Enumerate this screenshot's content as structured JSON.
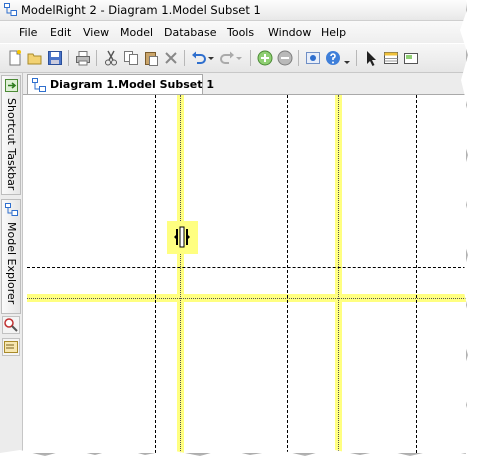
{
  "window": {
    "title": "ModelRight 2 - Diagram 1.Model Subset 1"
  },
  "menu": {
    "items": [
      "File",
      "Edit",
      "View",
      "Model",
      "Database",
      "Tools",
      "Window",
      "Help"
    ]
  },
  "toolbar": {
    "icons": [
      "new-icon",
      "open-icon",
      "save-icon",
      "print-icon",
      "cut-icon",
      "copy-icon",
      "paste-icon",
      "delete-icon",
      "undo-icon",
      "redo-icon",
      "zoom-in-icon",
      "zoom-out-icon",
      "properties-icon",
      "help-icon",
      "pointer-icon",
      "table-icon"
    ]
  },
  "sidebar": {
    "tabs": [
      {
        "label": "Shortcut Taskbar"
      },
      {
        "label": "Model Explorer"
      }
    ]
  },
  "document": {
    "tab_label": "Diagram 1.Model Subset 1"
  },
  "colors": {
    "highlight": "#ffff80",
    "accent_blue": "#2f6fce",
    "toolbar_bg": "#eeeeee"
  }
}
